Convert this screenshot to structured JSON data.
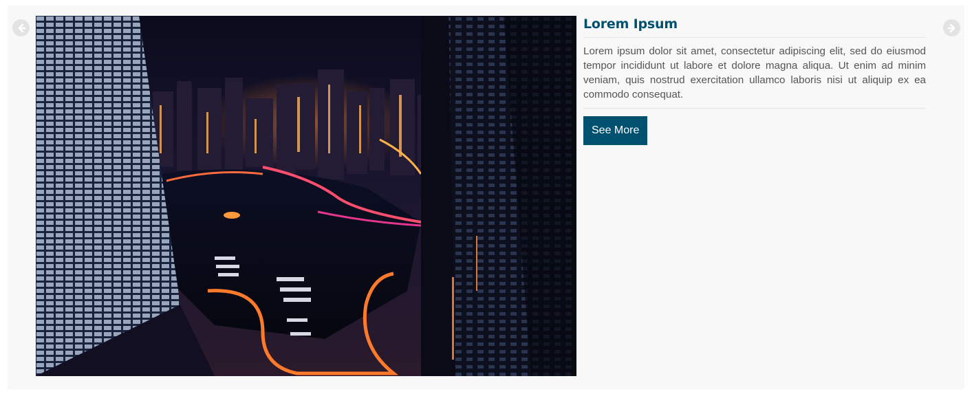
{
  "carousel": {
    "prev_icon": "arrow-left-circle-icon",
    "next_icon": "arrow-right-circle-icon",
    "slide": {
      "image_description": "night-city-marina",
      "title": "Lorem Ipsum",
      "description": "Lorem ipsum dolor sit amet, consectetur adipiscing elit, sed do eiusmod tempor incididunt ut labore et dolore magna aliqua. Ut enim ad minim veniam, quis nostrud exercitation ullamco laboris nisi ut aliquip ex ea commodo consequat.",
      "button_label": "See More"
    }
  },
  "colors": {
    "accent": "#005170",
    "panel_background": "#f8f8f8",
    "arrow_background": "#e3e3e3",
    "text": "#555555"
  }
}
